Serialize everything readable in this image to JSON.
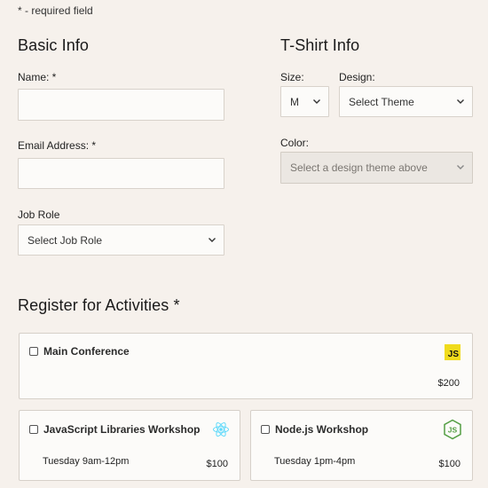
{
  "required_note": "* - required field",
  "basic_info": {
    "title": "Basic Info",
    "name_label": "Name: *",
    "name_value": "",
    "email_label": "Email Address: *",
    "email_value": "",
    "job_role_label": "Job Role",
    "job_role_selected": "Select Job Role"
  },
  "tshirt_info": {
    "title": "T-Shirt Info",
    "size_label": "Size:",
    "size_selected": "M",
    "design_label": "Design:",
    "design_selected": "Select Theme",
    "color_label": "Color:",
    "color_selected": "Select a design theme above"
  },
  "activities": {
    "title": "Register for Activities *",
    "items": [
      {
        "name": "Main Conference",
        "time": "",
        "price": "$200",
        "icon": "javascript-icon",
        "checked": false
      },
      {
        "name": "JavaScript Libraries Workshop",
        "time": "Tuesday 9am-12pm",
        "price": "$100",
        "icon": "react-icon",
        "checked": false
      },
      {
        "name": "Node.js Workshop",
        "time": "Tuesday 1pm-4pm",
        "price": "$100",
        "icon": "nodejs-icon",
        "checked": false
      }
    ]
  },
  "colors": {
    "background": "#f6f1ec",
    "field_background": "#fcfbf9",
    "border": "#d8d2cb",
    "javascript_yellow": "#f0db1c",
    "react_cyan": "#61dafb",
    "nodejs_green": "#539e43"
  }
}
